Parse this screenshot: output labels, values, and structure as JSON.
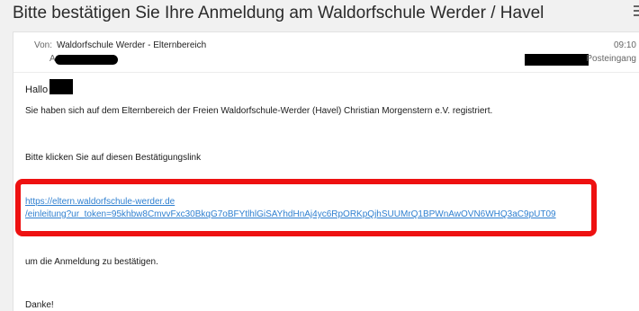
{
  "email": {
    "subject": "Bitte bestätigen Sie Ihre Anmeldung am Waldorfschule Werder / Havel",
    "from_label": "Von:",
    "from_value": "Waldorfschule Werder - Elternbereich",
    "to_label": "An:",
    "time": "09:10",
    "folder": "Posteingang"
  },
  "body": {
    "greeting": "Hallo",
    "line1": "Sie haben sich auf dem Elternbereich der Freien Waldorfschule-Werder (Havel) Christian Morgenstern e.V.  registriert.",
    "line2": "Bitte klicken Sie auf diesen Bestätigungslink",
    "link_line1": "https://eltern.waldorfschule-werder.de",
    "link_line2": "/einleitung?ur_token=95khbw8CmvvFxc30BkqG7oBFYtlhlGiSAYhdHnAj4yc6RpORKpQjhSUUMrQ1BPWnAwOVN6WHQ3aC9pUT09",
    "line3": "um die Anmeldung zu bestätigen.",
    "line4": "Danke!"
  },
  "colors": {
    "highlight_border": "#ee1111",
    "link": "#2e7fd0"
  }
}
